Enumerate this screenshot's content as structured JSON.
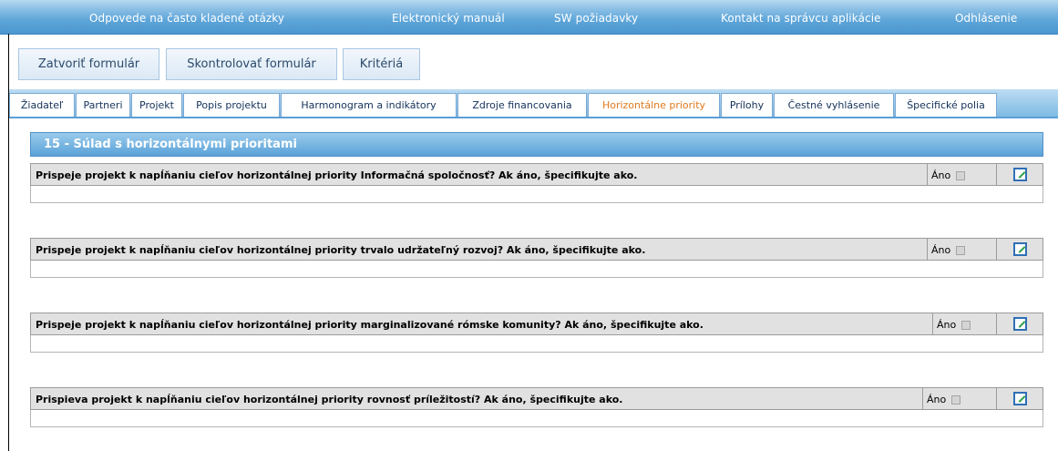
{
  "topnav": {
    "faq": "Odpovede na často kladené otázky",
    "manual": "Elektronický manuál",
    "sw": "SW požiadavky",
    "contact": "Kontakt na správcu aplikácie",
    "logout": "Odhlásenie"
  },
  "toolbar": {
    "close": "Zatvoriť formulár",
    "check": "Skontrolovať formulár",
    "criteria": "Kritériá"
  },
  "tabs": [
    {
      "label": "Žiadateľ"
    },
    {
      "label": "Partneri"
    },
    {
      "label": "Projekt"
    },
    {
      "label": "Popis projektu"
    },
    {
      "label": "Harmonogram a indikátory"
    },
    {
      "label": "Zdroje financovania"
    },
    {
      "label": "Horizontálne priority"
    },
    {
      "label": "Prílohy"
    },
    {
      "label": "Čestné vyhlásenie"
    },
    {
      "label": "Špecifické polia"
    }
  ],
  "active_tab": "Horizontálne priority",
  "section": {
    "title": "15 - Súlad s horizontálnymi prioritami"
  },
  "questions": [
    {
      "text": "Prispeje projekt k napĺňaniu cieľov horizontálnej priority Informačná spoločnosť? Ak áno, špecifikujte ako.",
      "ano_label": "Áno",
      "checked": false,
      "answer": ""
    },
    {
      "text": "Prispeje projekt k napĺňaniu cieľov horizontálnej priority trvalo udržateľný rozvoj? Ak áno, špecifikujte ako.",
      "ano_label": "Áno",
      "checked": false,
      "answer": ""
    },
    {
      "text": "Prispeje projekt k napĺňaniu cieľov horizontálnej priority marginalizované rómske komunity? Ak áno, špecifikujte ako.",
      "ano_label": "Áno",
      "checked": false,
      "answer": ""
    },
    {
      "text": "Prispieva projekt k napĺňaniu cieľov horizontálnej priority rovnosť príležitostí? Ak áno, špecifikujte ako.",
      "ano_label": "Áno",
      "checked": false,
      "answer": ""
    }
  ],
  "colors": {
    "nav_blue": "#5ea6d9",
    "active_tab": "#e07a1f",
    "row_gray": "#e1e1e1"
  }
}
